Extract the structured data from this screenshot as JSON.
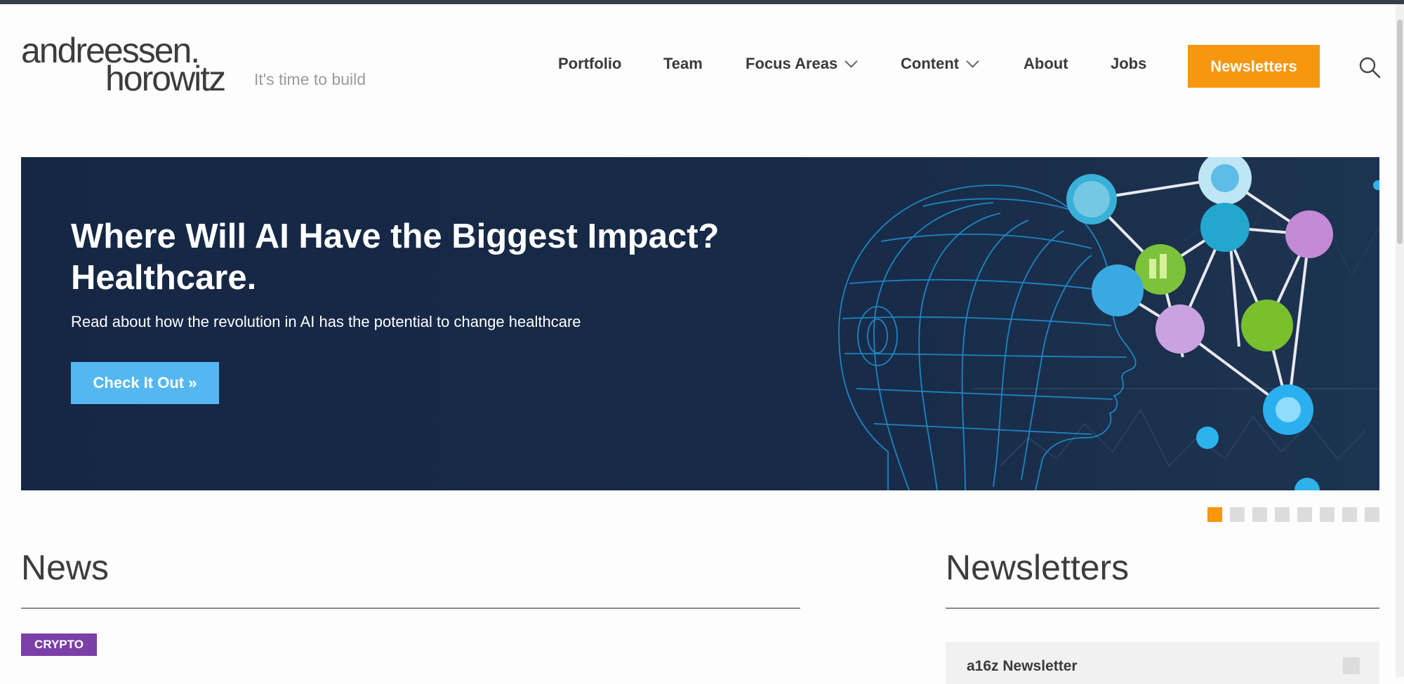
{
  "brand": {
    "logo_line1": "andreessen.",
    "logo_line2": "horowitz",
    "tagline": "It's time to build"
  },
  "nav": {
    "items": [
      {
        "label": "Portfolio"
      },
      {
        "label": "Team"
      },
      {
        "label": "Focus Areas"
      },
      {
        "label": "Content"
      },
      {
        "label": "About"
      },
      {
        "label": "Jobs"
      }
    ],
    "newsletters_button": "Newsletters"
  },
  "hero": {
    "title_line1": "Where Will AI Have the Biggest Impact?",
    "title_line2": "Healthcare.",
    "subtitle": "Read about how the revolution in AI has the potential to change healthcare",
    "cta": "Check It Out »"
  },
  "carousel": {
    "active_index": 0
  },
  "news": {
    "title": "News",
    "first_tag": "CRYPTO"
  },
  "newsletters": {
    "title": "Newsletters",
    "first_item": "a16z Newsletter"
  },
  "colors": {
    "accent_orange": "#f7960f",
    "cta_blue": "#55b7f0",
    "hero_bg": "#172a48",
    "crypto_purple": "#7b3fa8"
  }
}
